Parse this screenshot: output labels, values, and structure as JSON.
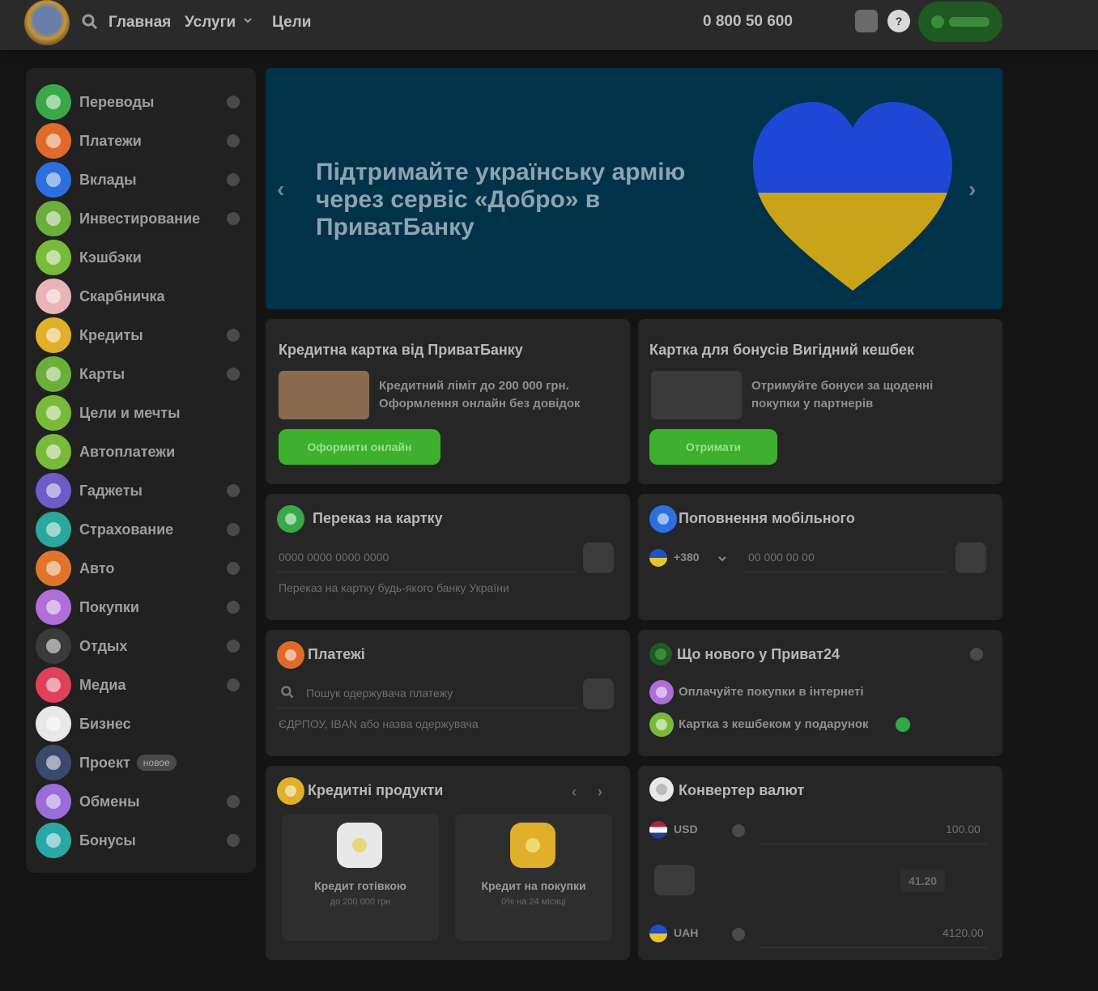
{
  "topbar": {
    "nav": [
      "Главная",
      "Услуги",
      "Цели"
    ],
    "phone": "0 800 50 600",
    "help_label": "?"
  },
  "sidebar": {
    "items": [
      {
        "label": "Переводы",
        "color": "#3aa84a",
        "plus": true
      },
      {
        "label": "Платежи",
        "color": "#e06a2a",
        "plus": true
      },
      {
        "label": "Вклады",
        "color": "#2e6fe0",
        "plus": true
      },
      {
        "label": "Инвестирование",
        "color": "#6cae3a",
        "plus": true
      },
      {
        "label": "Кэшбэки",
        "color": "#7aba3a",
        "plus": false
      },
      {
        "label": "Скарбничка",
        "color": "#e8b4b8",
        "plus": false
      },
      {
        "label": "Кредиты",
        "color": "#e0b02a",
        "plus": true
      },
      {
        "label": "Карты",
        "color": "#6cae3a",
        "plus": true
      },
      {
        "label": "Цели и мечты",
        "color": "#7aba3a",
        "plus": false
      },
      {
        "label": "Автоплатежи",
        "color": "#7aba3a",
        "plus": false
      },
      {
        "label": "Гаджеты",
        "color": "#6e5cc8",
        "plus": true
      },
      {
        "label": "Страхование",
        "color": "#2aa89a",
        "plus": true
      },
      {
        "label": "Авто",
        "color": "#e0742a",
        "plus": true
      },
      {
        "label": "Покупки",
        "color": "#b06ed8",
        "plus": true
      },
      {
        "label": "Отдых",
        "color": "#3a3a3a",
        "plus": true
      },
      {
        "label": "Медиа",
        "color": "#e0405a",
        "plus": true
      },
      {
        "label": "Бизнес",
        "color": "#e8e8e8",
        "plus": false
      },
      {
        "label": "Проект",
        "color": "#3a4a6a",
        "plus": false,
        "badge": "новое"
      },
      {
        "label": "Обмены",
        "color": "#9a6ed8",
        "plus": true
      },
      {
        "label": "Бонусы",
        "color": "#2aa8a8",
        "plus": true
      }
    ]
  },
  "banner": {
    "text": "Підтримайте українську армію через сервіс «Добро» в ПриватБанку",
    "prev": "‹",
    "next": "›"
  },
  "cards": {
    "card_offer": {
      "title": "Кредитна картка від ПриватБанку",
      "desc": "Кредитний ліміт до 200 000 грн. Оформлення онлайн без довідок",
      "button": "Оформити онлайн"
    },
    "bonus_offer": {
      "title": "Картка для бонусів Вигідний кешбек",
      "desc": "Отримуйте бонуси за щоденні покупки у партнерів",
      "button": "Отримати"
    },
    "transfer": {
      "title": "Переказ на картку",
      "placeholder": "0000 0000 0000 0000",
      "hint": "Переказ на картку будь-якого банку України"
    },
    "mobile": {
      "title": "Поповнення мобільного",
      "country_code": "+380",
      "placeholder": "00 000 00 00"
    },
    "payments": {
      "title": "Платежі",
      "placeholder": "Пошук одержувача платежу",
      "hint": "ЄДРПОУ, IBAN або назва одержувача"
    },
    "news": {
      "title": "Що нового у Приват24",
      "items": [
        {
          "text": "Оплачуйте покупки в інтернеті",
          "color": "#b06ed8"
        },
        {
          "text": "Картка з кешбеком у подарунок",
          "color": "#7aba3a"
        }
      ]
    },
    "products": {
      "title": "Кредитні продукти",
      "items": [
        {
          "title": "Кредит готівкою",
          "sub": "до 200 000 грн",
          "color": "#e8e8e8"
        },
        {
          "title": "Кредит на покупки",
          "sub": "0% на 24 місяці",
          "color": "#e0b02a"
        }
      ]
    },
    "exchange": {
      "title": "Конвертер валют",
      "from_currency": "USD",
      "to_currency": "UAH",
      "from_amount": "100.00",
      "to_amount": "4120.00",
      "rate": "41.20"
    }
  }
}
